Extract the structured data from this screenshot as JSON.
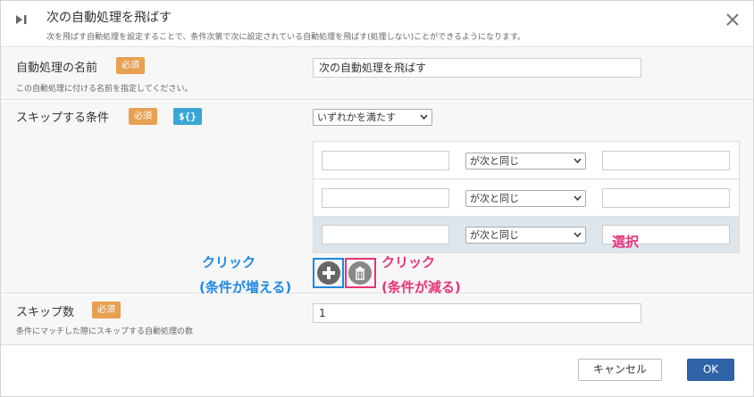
{
  "dialog": {
    "title": "次の自動処理を飛ばす",
    "subtitle": "次を飛ばす自動処理を設定することで、条件次第で次に設定されている自動処理を飛ばす(処理しない)ことができるようになります。",
    "header_icon": "skip-next-icon",
    "close_icon": "close-icon"
  },
  "name_field": {
    "label": "自動処理の名前",
    "required_badge": "必須",
    "hint": "この自動処理に付ける名前を指定してください。",
    "value": "次の自動処理を飛ばす"
  },
  "skip_condition": {
    "label": "スキップする条件",
    "required_badge": "必須",
    "variable_badge": "${}",
    "match_mode": "いずれかを満たす",
    "rows": [
      {
        "left": "",
        "operator": "が次と同じ",
        "right": ""
      },
      {
        "left": "",
        "operator": "が次と同じ",
        "right": ""
      },
      {
        "left": "",
        "operator": "が次と同じ",
        "right": ""
      }
    ],
    "add_icon": "plus-icon",
    "delete_icon": "trash-icon"
  },
  "skip_count": {
    "label": "スキップ数",
    "required_badge": "必須",
    "hint": "条件にマッチした際にスキップする自動処理の数",
    "value": "1"
  },
  "annotations": {
    "add_line1": "クリック",
    "add_line2": "(条件が増える)",
    "delete_line1": "クリック",
    "delete_line2": "(条件が減る)",
    "select_note": "選択",
    "blue": "#1e88e5",
    "pink": "#e8337a"
  },
  "footer": {
    "cancel_label": "キャンセル",
    "ok_label": "OK"
  }
}
